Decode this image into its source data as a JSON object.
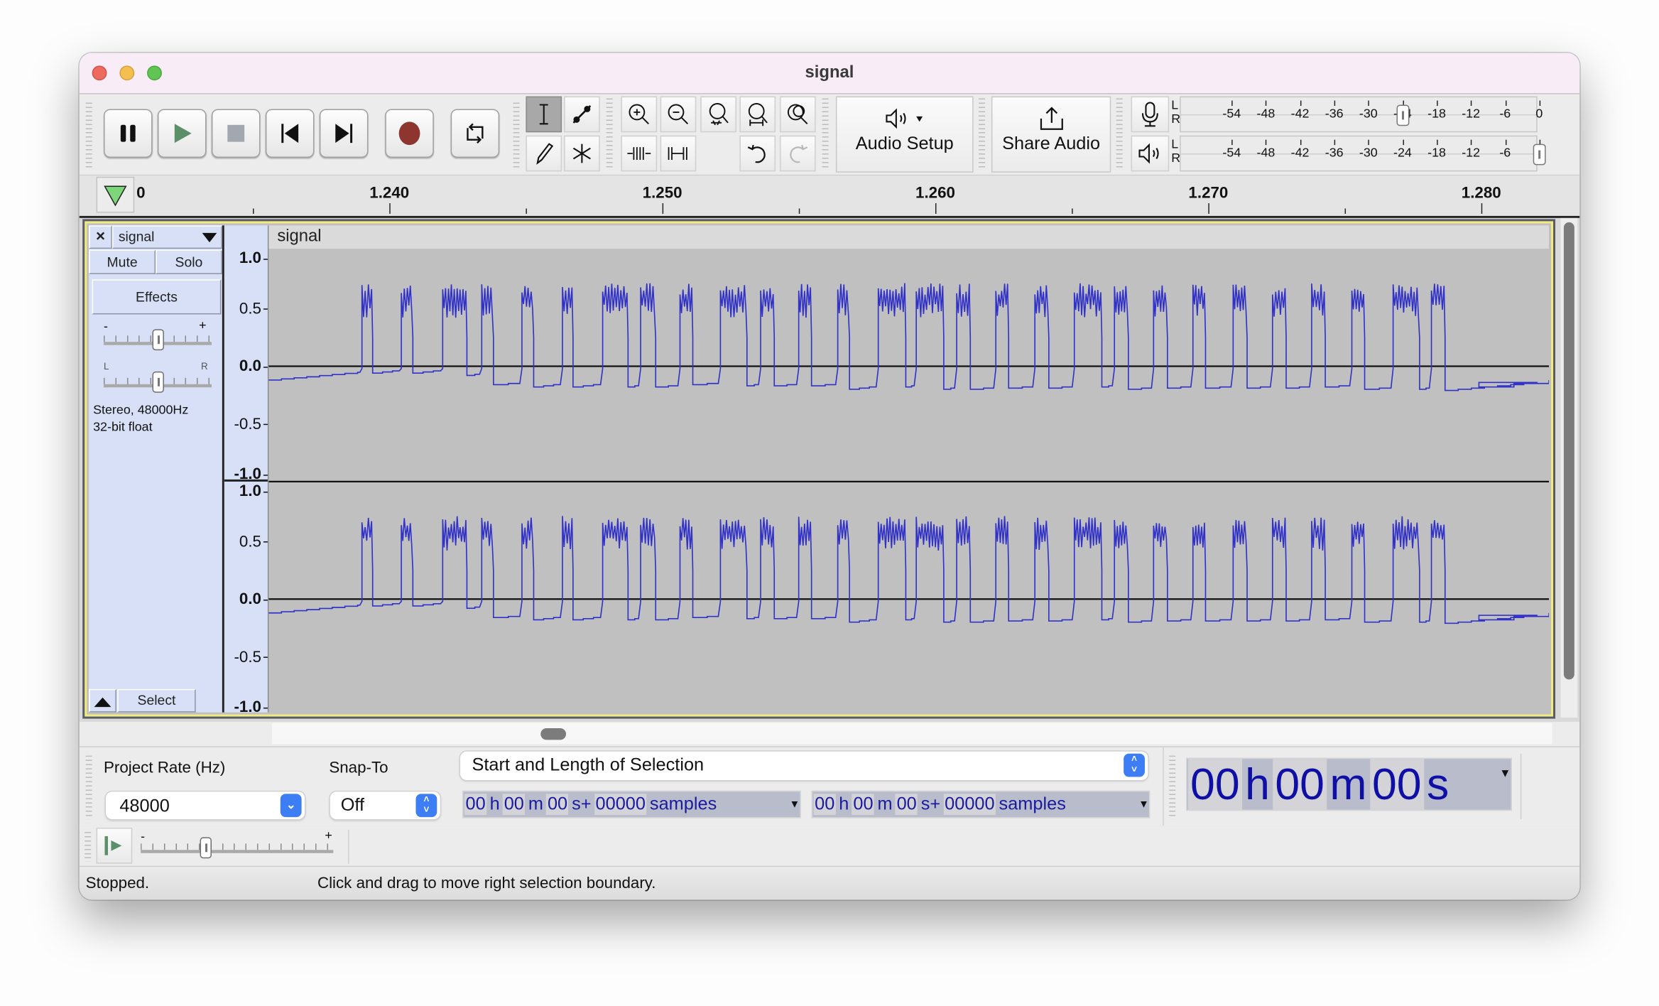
{
  "window": {
    "title": "signal",
    "traffic_lights": [
      {
        "name": "close",
        "color": "#ed6a5e"
      },
      {
        "name": "minimize",
        "color": "#f5bf4f"
      },
      {
        "name": "zoom",
        "color": "#61c554"
      }
    ]
  },
  "transport": {
    "buttons": [
      {
        "name": "pause",
        "icon": "pause-icon"
      },
      {
        "name": "play",
        "icon": "play-icon"
      },
      {
        "name": "stop",
        "icon": "stop-icon"
      },
      {
        "name": "skip-to-start",
        "icon": "skip-start-icon"
      },
      {
        "name": "skip-to-end",
        "icon": "skip-end-icon"
      },
      {
        "name": "record",
        "icon": "record-icon"
      },
      {
        "name": "loop",
        "icon": "loop-icon"
      }
    ],
    "colors": {
      "play": "#5b8f6a",
      "record": "#8e3530",
      "stop": "#a3a7b0"
    }
  },
  "tools": {
    "selection_tool": "I-beam",
    "active": "selection",
    "items": [
      "selection",
      "envelope",
      "draw",
      "multi",
      "zoom-in",
      "zoom-out",
      "fit-selection",
      "fit-project",
      "zoom-toggle",
      "trim-audio",
      "silence-audio",
      "undo",
      "redo"
    ]
  },
  "audio_setup": {
    "label": "Audio Setup"
  },
  "share_audio": {
    "label": "Share Audio"
  },
  "meters": {
    "record": {
      "channels": [
        "L",
        "R"
      ],
      "ticks": [
        "-54",
        "-48",
        "-42",
        "-36",
        "-30",
        "-24",
        "-18",
        "-12",
        "-6",
        "0"
      ],
      "level_db": -24
    },
    "playback": {
      "channels": [
        "L",
        "R"
      ],
      "ticks": [
        "-54",
        "-48",
        "-42",
        "-36",
        "-30",
        "-24",
        "-18",
        "-12",
        "-6",
        "0"
      ],
      "level_db": 0
    }
  },
  "ruler": {
    "labels": [
      "1.240",
      "1.250",
      "1.260",
      "1.270",
      "1.280"
    ],
    "partial_label": "0",
    "view_start_s": 1.23562,
    "view_end_s": 1.28244
  },
  "track": {
    "name": "signal",
    "clip_name": "signal",
    "mute_label": "Mute",
    "solo_label": "Solo",
    "effects_label": "Effects",
    "select_label": "Select",
    "gain": {
      "minus": "-",
      "plus": "+",
      "value_fraction": 0.5
    },
    "pan": {
      "left": "L",
      "right": "R",
      "value_fraction": 0.5
    },
    "info_line1": "Stereo, 48000Hz",
    "info_line2": "32-bit float",
    "y_labels": [
      "1.0",
      "0.5",
      "0.0",
      "-0.5",
      "-1.0"
    ],
    "wave_color": "#3232c8",
    "background_color": "#c0c0c0"
  },
  "waveform": {
    "baseline_start": -0.12,
    "baseline_end": -0.18,
    "high_level": 0.62,
    "pulses_s": [
      [
        1.23903,
        1.23938
      ],
      [
        1.24047,
        1.24085
      ],
      [
        1.24198,
        1.24283
      ],
      [
        1.24341,
        1.2438
      ],
      [
        1.24488,
        1.24527
      ],
      [
        1.24636,
        1.24671
      ],
      [
        1.24783,
        1.24872
      ],
      [
        1.24922,
        1.24973
      ],
      [
        1.25066,
        1.25109
      ],
      [
        1.25214,
        1.25307
      ],
      [
        1.25361,
        1.25407
      ],
      [
        1.255,
        1.25543
      ],
      [
        1.25643,
        1.25682
      ],
      [
        1.25791,
        1.25888
      ],
      [
        1.2593,
        1.26027
      ],
      [
        1.26078,
        1.26124
      ],
      [
        1.26221,
        1.26264
      ],
      [
        1.26364,
        1.26411
      ],
      [
        1.26508,
        1.26605
      ],
      [
        1.26655,
        1.26702
      ],
      [
        1.26798,
        1.26845
      ],
      [
        1.26942,
        1.26984
      ],
      [
        1.27089,
        1.27136
      ],
      [
        1.27233,
        1.27279
      ],
      [
        1.27376,
        1.27422
      ],
      [
        1.27523,
        1.27566
      ],
      [
        1.27674,
        1.27767
      ],
      [
        1.27814,
        1.2786
      ]
    ],
    "low_level_after_pulse": [
      -0.06,
      -0.06,
      -0.08,
      -0.16,
      -0.18,
      -0.18,
      -0.18,
      -0.18,
      -0.16,
      -0.17,
      -0.17,
      -0.17,
      -0.2,
      -0.18,
      -0.2,
      -0.2,
      -0.19,
      -0.19,
      -0.18,
      -0.2,
      -0.19,
      -0.19,
      -0.19,
      -0.19,
      -0.18,
      -0.2,
      -0.2,
      -0.21
    ]
  },
  "selection_toolbar": {
    "project_rate_label": "Project Rate (Hz)",
    "project_rate_value": "48000",
    "snap_to_label": "Snap-To",
    "snap_to_value": "Off",
    "selection_mode": "Start and Length of Selection",
    "start_time": {
      "h": "00",
      "m": "00",
      "s": "00",
      "samples": "00000",
      "h_unit": "h",
      "m_unit": "m",
      "s_unit": "s+",
      "samples_unit": "samples"
    },
    "length_time": {
      "h": "00",
      "m": "00",
      "s": "00",
      "samples": "00000",
      "h_unit": "h",
      "m_unit": "m",
      "s_unit": "s+",
      "samples_unit": "samples"
    }
  },
  "audio_position": {
    "h": "00",
    "m": "00",
    "s": "00",
    "h_unit": "h",
    "m_unit": "m",
    "s_unit": "s"
  },
  "play_at_speed": {
    "minus": "-",
    "plus": "+",
    "value_fraction": 0.33
  },
  "status": {
    "state": "Stopped.",
    "message": "Click and drag to move right selection boundary."
  }
}
